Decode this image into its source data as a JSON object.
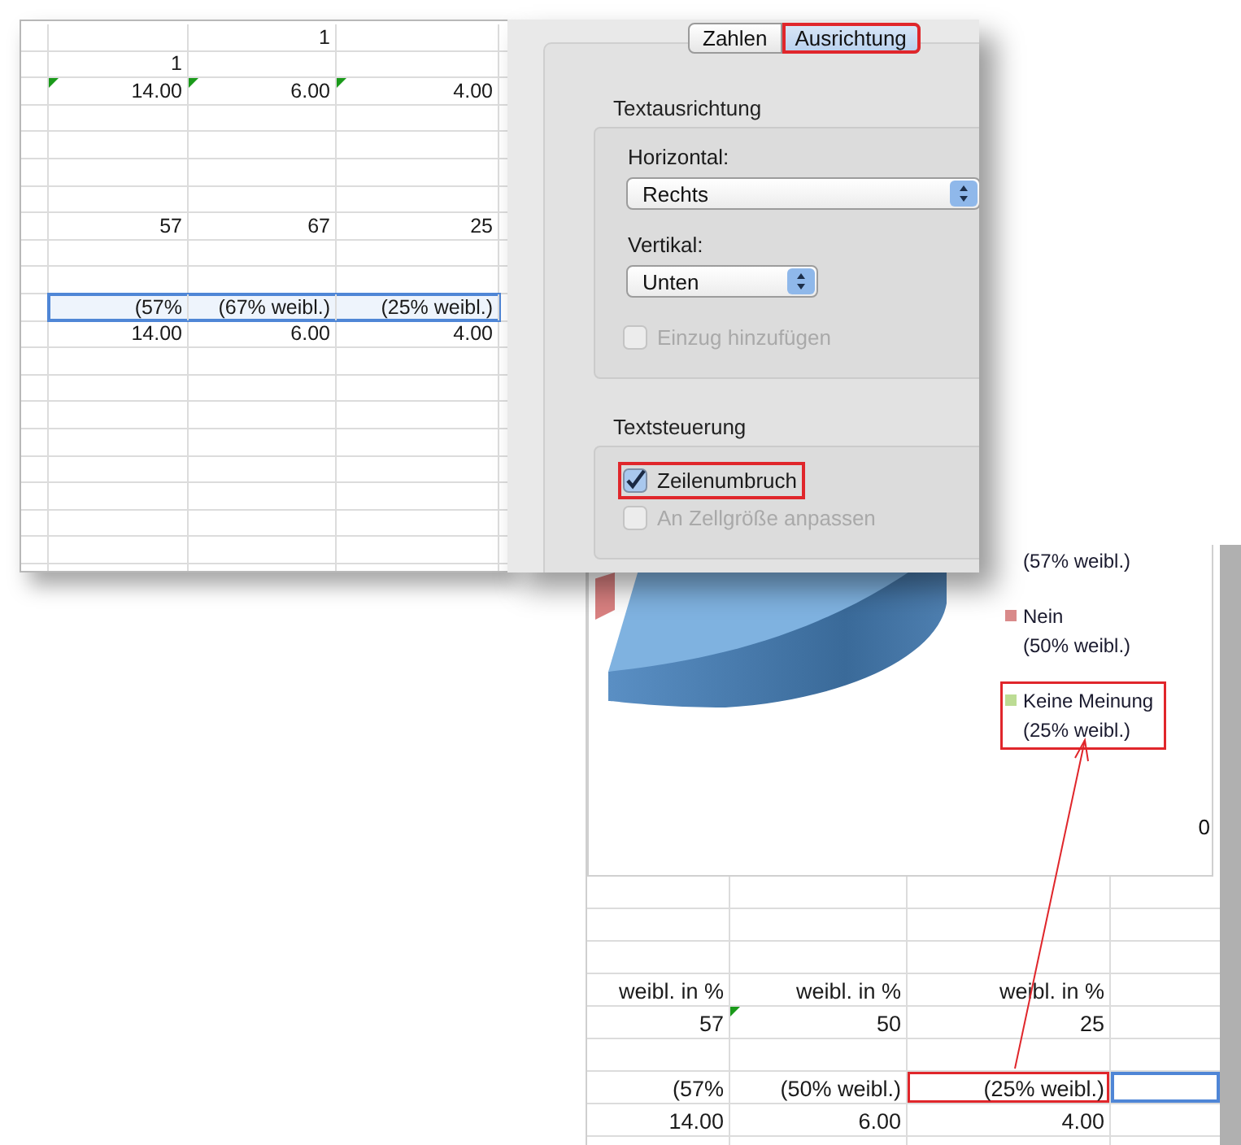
{
  "top_sheet": {
    "rows": [
      {
        "selected": false,
        "cells": [
          null,
          "1",
          null
        ]
      },
      {
        "selected": false,
        "cells": [
          "1",
          null,
          null
        ]
      },
      {
        "selected": false,
        "cells": [
          {
            "text": "14.00",
            "flagged": true
          },
          {
            "text": "6.00",
            "flagged": true
          },
          {
            "text": "4.00",
            "flagged": true
          }
        ]
      },
      {
        "selected": false,
        "cells": [
          "57",
          "67",
          "25"
        ]
      },
      {
        "selected": true,
        "cells": [
          "(57%",
          "(67% weibl.)",
          "(25% weibl.)"
        ]
      },
      {
        "selected": false,
        "cells": [
          "14.00",
          "6.00",
          "4.00"
        ]
      }
    ]
  },
  "dialog": {
    "tabs": [
      {
        "label": "Zahlen",
        "selected": false,
        "annotated": false
      },
      {
        "label": "Ausrichtung",
        "selected": true,
        "annotated": true
      }
    ],
    "sections": [
      {
        "title": "Textausrichtung",
        "controls": [
          {
            "kind": "label",
            "text": "Horizontal:"
          },
          {
            "kind": "popup",
            "value": "Rechts"
          },
          {
            "kind": "label",
            "text": "Vertikal:"
          },
          {
            "kind": "popup",
            "value": "Unten"
          },
          {
            "kind": "checkbox",
            "label": "Einzug hinzufügen",
            "checked": false,
            "disabled": true,
            "annotated": false
          }
        ]
      },
      {
        "title": "Textsteuerung",
        "controls": [
          {
            "kind": "checkbox",
            "label": "Zeilenumbruch",
            "checked": true,
            "disabled": false,
            "annotated": true
          },
          {
            "kind": "checkbox",
            "label": "An Zellgröße anpassen",
            "checked": false,
            "disabled": true,
            "annotated": false
          }
        ]
      }
    ]
  },
  "chart": {
    "legend": [
      {
        "lines": [
          "(57% weibl.)"
        ],
        "annotated": false
      },
      {
        "color": "#d98a8a",
        "lines": [
          "Nein",
          "(50% weibl.)"
        ],
        "annotated": false
      },
      {
        "color": "#bcdc94",
        "lines": [
          "Keine Meinung",
          "(25% weibl.)"
        ],
        "annotated": true
      }
    ],
    "axis_label": "0"
  },
  "bottom_sheet": {
    "rows": [
      {
        "cells": [
          "weibl. in %",
          "weibl. in %",
          "weibl. in %"
        ]
      },
      {
        "cells": [
          "57",
          {
            "text": "50",
            "flagged": true
          },
          "25"
        ]
      },
      {
        "cells": [
          {
            "text": "(57%",
            "annotated": false
          },
          {
            "text": "(50% weibl.)",
            "annotated": false
          },
          {
            "text": "(25% weibl.)",
            "annotated": true
          },
          {
            "selected": true,
            "annotated": false
          }
        ]
      },
      {
        "cells": [
          "14.00",
          "6.00",
          "4.00"
        ]
      }
    ]
  }
}
